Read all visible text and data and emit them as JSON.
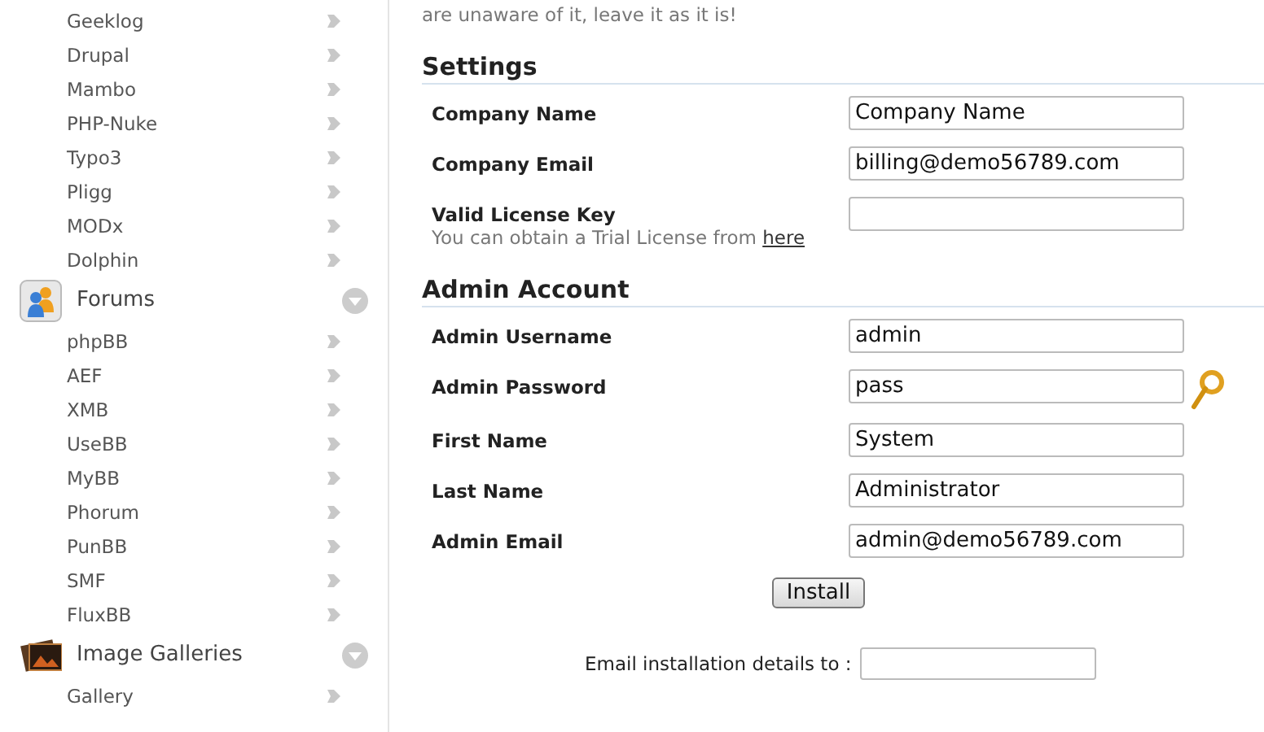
{
  "sidebar": {
    "items": [
      {
        "kind": "link",
        "label": "Geeklog"
      },
      {
        "kind": "link",
        "label": "Drupal"
      },
      {
        "kind": "link",
        "label": "Mambo"
      },
      {
        "kind": "link",
        "label": "PHP-Nuke"
      },
      {
        "kind": "link",
        "label": "Typo3"
      },
      {
        "kind": "link",
        "label": "Pligg"
      },
      {
        "kind": "link",
        "label": "MODx"
      },
      {
        "kind": "link",
        "label": "Dolphin"
      },
      {
        "kind": "category",
        "label": "Forums"
      },
      {
        "kind": "link",
        "label": "phpBB"
      },
      {
        "kind": "link",
        "label": "AEF"
      },
      {
        "kind": "link",
        "label": "XMB"
      },
      {
        "kind": "link",
        "label": "UseBB"
      },
      {
        "kind": "link",
        "label": "MyBB"
      },
      {
        "kind": "link",
        "label": "Phorum"
      },
      {
        "kind": "link",
        "label": "PunBB"
      },
      {
        "kind": "link",
        "label": "SMF"
      },
      {
        "kind": "link",
        "label": "FluxBB"
      },
      {
        "kind": "category",
        "label": "Image Galleries"
      },
      {
        "kind": "link",
        "label": "Gallery"
      }
    ]
  },
  "main": {
    "intro": "are unaware of it, leave it as it is!",
    "sections": [
      {
        "title": "Settings",
        "fields": [
          {
            "kind": "text",
            "label": "Company Name",
            "value": "Company Name"
          },
          {
            "kind": "text",
            "label": "Company Email",
            "value": "billing@demo56789.com"
          },
          {
            "kind": "text",
            "label": "Valid License Key",
            "hint": "You can obtain a Trial License from",
            "hint_link": "here"
          }
        ]
      },
      {
        "title": "Admin Account",
        "fields": [
          {
            "kind": "text",
            "label": "Admin Username",
            "value": "admin"
          },
          {
            "kind": "password",
            "label": "Admin Password",
            "value": "pass"
          },
          {
            "kind": "text",
            "label": "First Name",
            "value": "System"
          },
          {
            "kind": "text",
            "label": "Last Name",
            "value": "Administrator"
          },
          {
            "kind": "text",
            "label": "Admin Email",
            "value": "admin@demo56789.com"
          }
        ]
      }
    ],
    "install_button": "Install",
    "email_details": {
      "label": "Email installation details to :"
    }
  }
}
